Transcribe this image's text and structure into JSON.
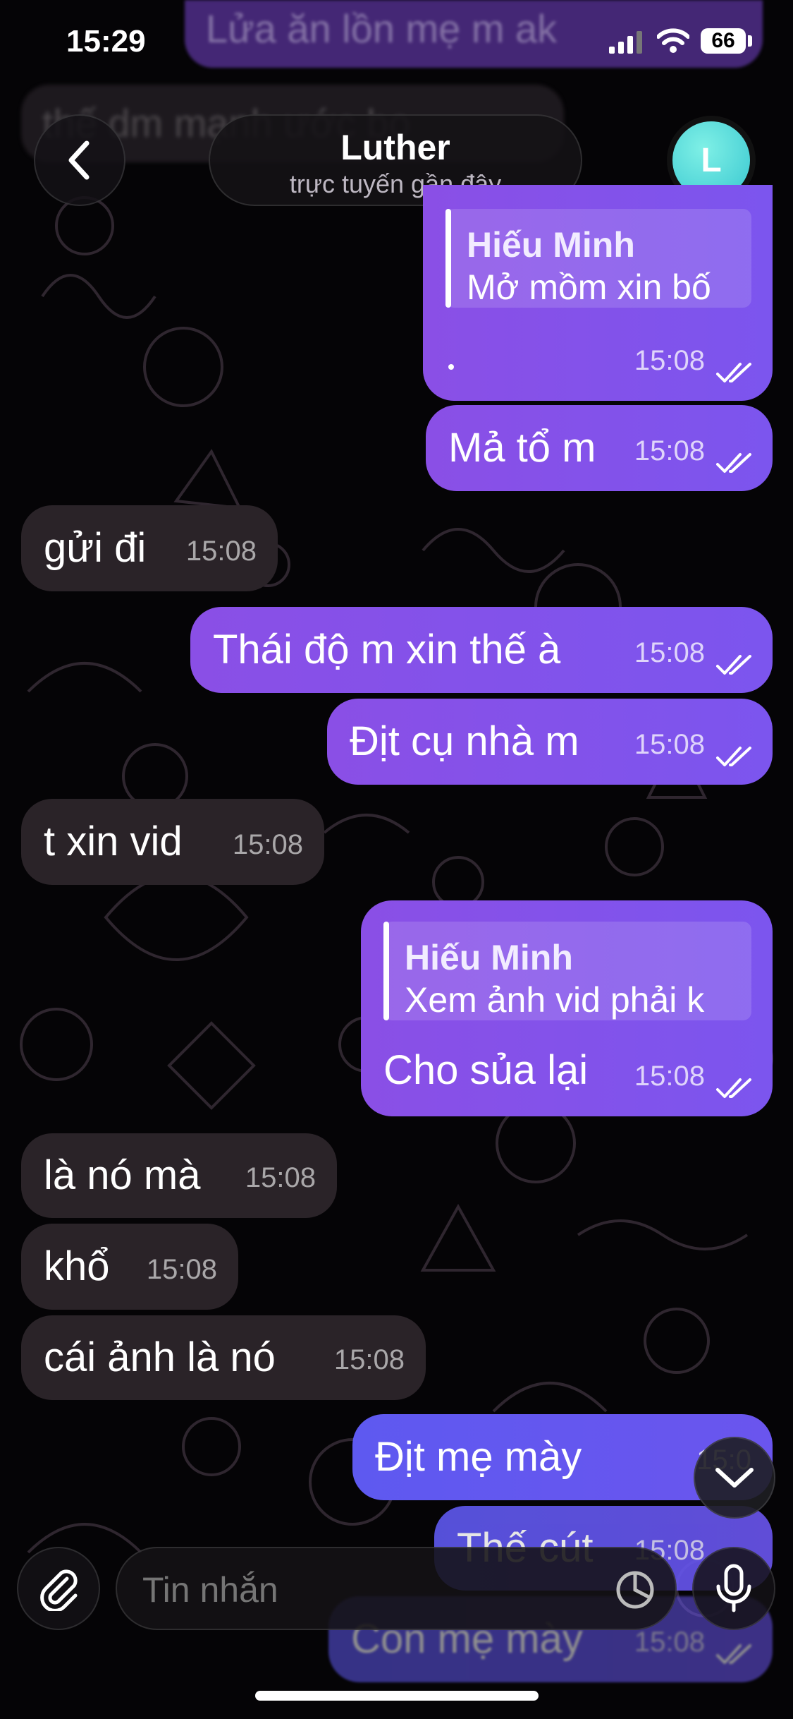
{
  "status_bar": {
    "time": "15:29",
    "battery": "66"
  },
  "header": {
    "contact_name": "Luther",
    "status": "trực tuyến gần đây",
    "avatar_letter": "L",
    "blurred_top_1": "Lửa ăn lồn mẹ m ak",
    "blurred_top_2": "thế dm mạnh ước bo"
  },
  "messages": [
    {
      "dir": "out",
      "reply_name": "Hiếu Minh",
      "reply_text": "Mở mồm xin bố",
      "text": "",
      "time": "15:08"
    },
    {
      "dir": "out",
      "text": "Mả tổ m",
      "time": "15:08"
    },
    {
      "dir": "in",
      "text": "gửi đi",
      "time": "15:08"
    },
    {
      "dir": "out",
      "text": "Thái độ m xin thế à",
      "time": "15:08"
    },
    {
      "dir": "out",
      "text": "Địt cụ nhà m",
      "time": "15:08"
    },
    {
      "dir": "in",
      "text": "t xin vid",
      "time": "15:08"
    },
    {
      "dir": "out",
      "reply_name": "Hiếu Minh",
      "reply_text": "Xem ảnh vid phải k",
      "text": "Cho sủa lại",
      "time": "15:08"
    },
    {
      "dir": "in",
      "text": "là nó mà",
      "time": "15:08"
    },
    {
      "dir": "in",
      "text": "khổ",
      "time": "15:08"
    },
    {
      "dir": "in",
      "text": "cái ảnh là nó",
      "time": "15:08"
    },
    {
      "dir": "out",
      "text": "Địt mẹ mày",
      "time": "15:0"
    },
    {
      "dir": "out",
      "text": "Thế cút",
      "time": "15:08"
    },
    {
      "dir": "out",
      "text": "Con mẹ mày",
      "time": "15:08"
    }
  ],
  "composer": {
    "placeholder": "Tin nhắn"
  },
  "colors": {
    "outgoing": "#8a4fe6",
    "outgoing_blue": "#5e59f0",
    "incoming": "#2a2328",
    "avatar": "#5fe3dd"
  },
  "icons": [
    "back-chevron-icon",
    "attach-icon",
    "sticker-icon",
    "microphone-icon",
    "scroll-down-icon",
    "read-ticks-icon"
  ]
}
